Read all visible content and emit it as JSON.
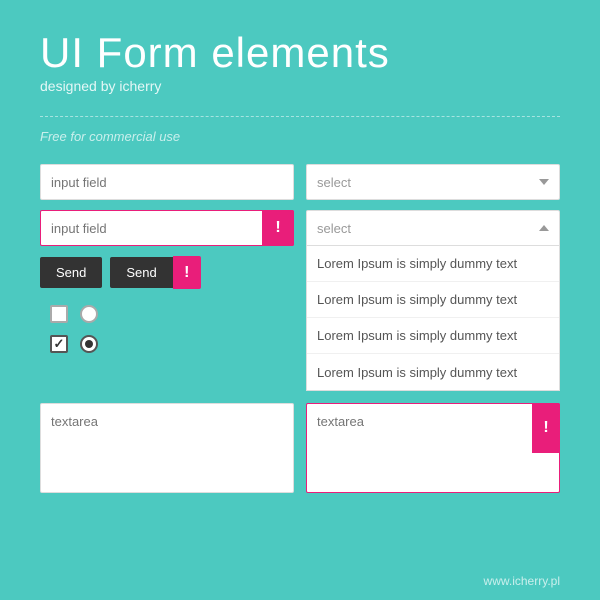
{
  "header": {
    "title": "UI Form elements",
    "subtitle": "designed by icherry",
    "free_text": "Free for commercial use"
  },
  "left_col": {
    "input1_placeholder": "input field",
    "input2_placeholder": "input field",
    "btn1_label": "Send",
    "btn2_label": "Send",
    "error_symbol": "!"
  },
  "right_col": {
    "select_placeholder": "select",
    "select_open_placeholder": "select",
    "dropdown_items": [
      "Lorem Ipsum is simply dummy text",
      "Lorem Ipsum is simply dummy text",
      "Lorem Ipsum is simply dummy text",
      "Lorem Ipsum is simply dummy text"
    ]
  },
  "textareas": {
    "ta1_placeholder": "textarea",
    "ta2_placeholder": "textarea",
    "error_symbol": "!"
  },
  "footer": {
    "url": "www.icherry.pl"
  }
}
